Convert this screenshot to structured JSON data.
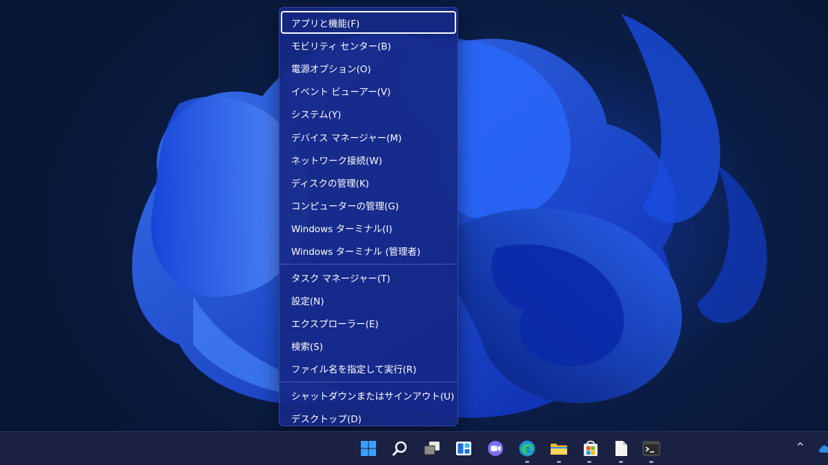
{
  "context_menu": {
    "groups": [
      [
        {
          "label": "アプリと機能(F)",
          "focused": true
        },
        {
          "label": "モビリティ センター(B)"
        },
        {
          "label": "電源オプション(O)"
        },
        {
          "label": "イベント ビューアー(V)"
        },
        {
          "label": "システム(Y)"
        },
        {
          "label": "デバイス マネージャー(M)"
        },
        {
          "label": "ネットワーク接続(W)"
        },
        {
          "label": "ディスクの管理(K)"
        },
        {
          "label": "コンピューターの管理(G)"
        },
        {
          "label": "Windows ターミナル(I)"
        },
        {
          "label": "Windows ターミナル (管理者)"
        }
      ],
      [
        {
          "label": "タスク マネージャー(T)"
        },
        {
          "label": "設定(N)"
        },
        {
          "label": "エクスプローラー(E)"
        },
        {
          "label": "検索(S)"
        },
        {
          "label": "ファイル名を指定して実行(R)"
        }
      ],
      [
        {
          "label": "シャットダウンまたはサインアウト(U)",
          "submenu_arrow": "›"
        },
        {
          "label": "デスクトップ(D)"
        }
      ]
    ]
  },
  "taskbar": {
    "icons": [
      {
        "name": "start-icon",
        "running": false
      },
      {
        "name": "search-icon",
        "running": false
      },
      {
        "name": "task-view-icon",
        "running": false
      },
      {
        "name": "widgets-icon",
        "running": false
      },
      {
        "name": "chat-icon",
        "running": false
      },
      {
        "name": "edge-icon",
        "running": true
      },
      {
        "name": "file-explorer-icon",
        "running": true
      },
      {
        "name": "store-icon",
        "running": true
      },
      {
        "name": "notepad-icon",
        "running": true
      },
      {
        "name": "terminal-icon",
        "running": true
      }
    ],
    "tray": {
      "overflow_chevron": "^",
      "onedrive_icon": "onedrive-icon"
    }
  }
}
